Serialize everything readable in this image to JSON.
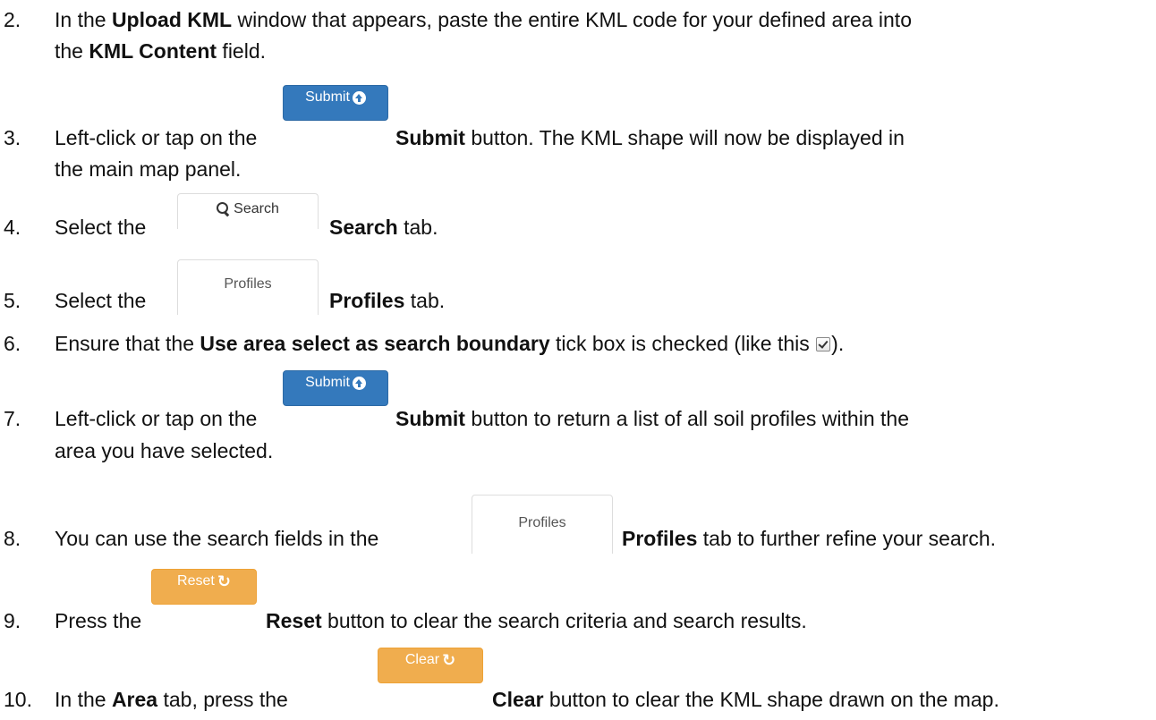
{
  "steps": [
    {
      "num": "2.",
      "l1_a": "In the ",
      "l1_b": "Upload KML",
      "l1_c": " window that appears, paste the entire KML code for your defined area into",
      "l2_a": "the ",
      "l2_b": "KML Content",
      "l2_c": " field."
    },
    {
      "num": "3.",
      "l1_a": "Left-click or tap on the",
      "button_label": "Submit",
      "l1_b": "Submit",
      "l1_c": " button. The KML shape will now be displayed in",
      "l2_a": "the main map panel."
    },
    {
      "num": "4.",
      "l1_a": "Select the",
      "tab_label": "Search",
      "l1_b": "Search",
      "l1_c": " tab."
    },
    {
      "num": "5.",
      "l1_a": "Select the",
      "tab_label": "Profiles",
      "l1_b": "Profiles",
      "l1_c": " tab."
    },
    {
      "num": "6.",
      "l1_a": "Ensure that the ",
      "l1_b": "Use area select as search boundary",
      "l1_c": " tick box is checked (like this ",
      "l1_d": ")."
    },
    {
      "num": "7.",
      "l1_a": "Left-click or tap on the",
      "button_label": "Submit",
      "l1_b": "Submit",
      "l1_c": " button to return a list of all soil profiles within the",
      "l2_a": "area you have selected."
    },
    {
      "num": "8.",
      "l1_a": "You can use the search fields in the",
      "tab_label": "Profiles",
      "l1_b": "Profiles",
      "l1_c": " tab to further refine your search."
    },
    {
      "num": "9.",
      "l1_a": "Press the",
      "button_label": "Reset",
      "l1_b": "Reset",
      "l1_c": " button to clear the search criteria and search results."
    },
    {
      "num": "10.",
      "l1_a": "In the ",
      "l1_b": "Area",
      "l1_c": " tab, press the",
      "button_label": "Clear",
      "l1_d": "Clear",
      "l1_e": " button to clear the KML shape drawn on the map."
    }
  ],
  "colors": {
    "primary_button": "#3479bc",
    "warning_button": "#f0ad4e",
    "tab_border": "#dddddd"
  },
  "icons": {
    "submit": "circle-arrow-up-icon",
    "search": "magnifier-icon",
    "reset": "refresh-icon",
    "clear": "refresh-icon",
    "checkbox": "checked-checkbox-icon"
  }
}
